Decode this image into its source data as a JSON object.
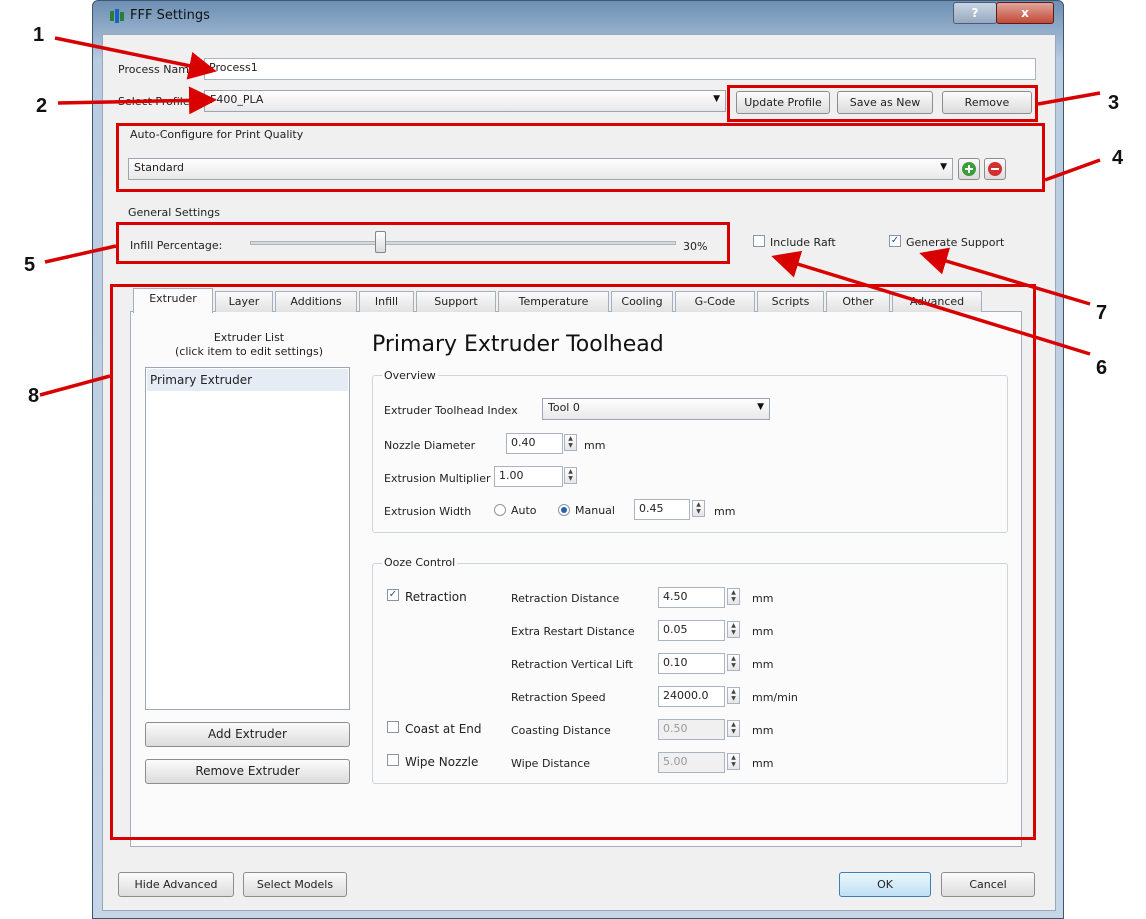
{
  "window": {
    "title": "FFF Settings",
    "help": "?",
    "close": "x"
  },
  "callouts": [
    "1",
    "2",
    "3",
    "4",
    "5",
    "6",
    "7",
    "8"
  ],
  "process": {
    "name_label": "Process Name",
    "name_value": "Process1"
  },
  "profile": {
    "label": "Select Profile",
    "value": "F400_PLA",
    "update": "Update Profile",
    "save_as_new": "Save as New",
    "remove": "Remove"
  },
  "auto_configure": {
    "label": "Auto-Configure for Print Quality",
    "value": "Standard"
  },
  "general": {
    "label": "General Settings",
    "infill_label": "Infill Percentage:",
    "infill_value": "30%",
    "infill_fraction": 0.3,
    "include_raft": "Include Raft",
    "include_raft_checked": false,
    "generate_support": "Generate Support",
    "generate_support_checked": true
  },
  "tabs": [
    "Extruder",
    "Layer",
    "Additions",
    "Infill",
    "Support",
    "Temperature",
    "Cooling",
    "G-Code",
    "Scripts",
    "Other",
    "Advanced"
  ],
  "extruder_list": {
    "title_line1": "Extruder List",
    "title_line2": "(click item to edit settings)",
    "items": [
      "Primary Extruder"
    ],
    "add": "Add Extruder",
    "remove": "Remove Extruder"
  },
  "toolhead": {
    "heading": "Primary Extruder Toolhead",
    "overview_label": "Overview",
    "index_label": "Extruder Toolhead Index",
    "index_value": "Tool 0",
    "nozzle_label": "Nozzle Diameter",
    "nozzle_value": "0.40",
    "nozzle_unit": "mm",
    "mult_label": "Extrusion Multiplier",
    "mult_value": "1.00",
    "width_label": "Extrusion Width",
    "width_auto": "Auto",
    "width_manual": "Manual",
    "width_value": "0.45",
    "width_unit": "mm"
  },
  "ooze": {
    "label": "Ooze Control",
    "retraction": "Retraction",
    "retraction_checked": true,
    "coast": "Coast at End",
    "coast_checked": false,
    "wipe": "Wipe Nozzle",
    "wipe_checked": false,
    "rows": [
      {
        "label": "Retraction Distance",
        "value": "4.50",
        "unit": "mm"
      },
      {
        "label": "Extra Restart Distance",
        "value": "0.05",
        "unit": "mm"
      },
      {
        "label": "Retraction Vertical Lift",
        "value": "0.10",
        "unit": "mm"
      },
      {
        "label": "Retraction Speed",
        "value": "24000.0",
        "unit": "mm/min"
      },
      {
        "label": "Coasting Distance",
        "value": "0.50",
        "unit": "mm"
      },
      {
        "label": "Wipe Distance",
        "value": "5.00",
        "unit": "mm"
      }
    ]
  },
  "footer": {
    "hide_advanced": "Hide Advanced",
    "select_models": "Select Models",
    "ok": "OK",
    "cancel": "Cancel"
  },
  "colors": {
    "annotation": "#d90000",
    "titlebar": "#6d8fb3",
    "dialog_bg": "#f0f0f0"
  }
}
